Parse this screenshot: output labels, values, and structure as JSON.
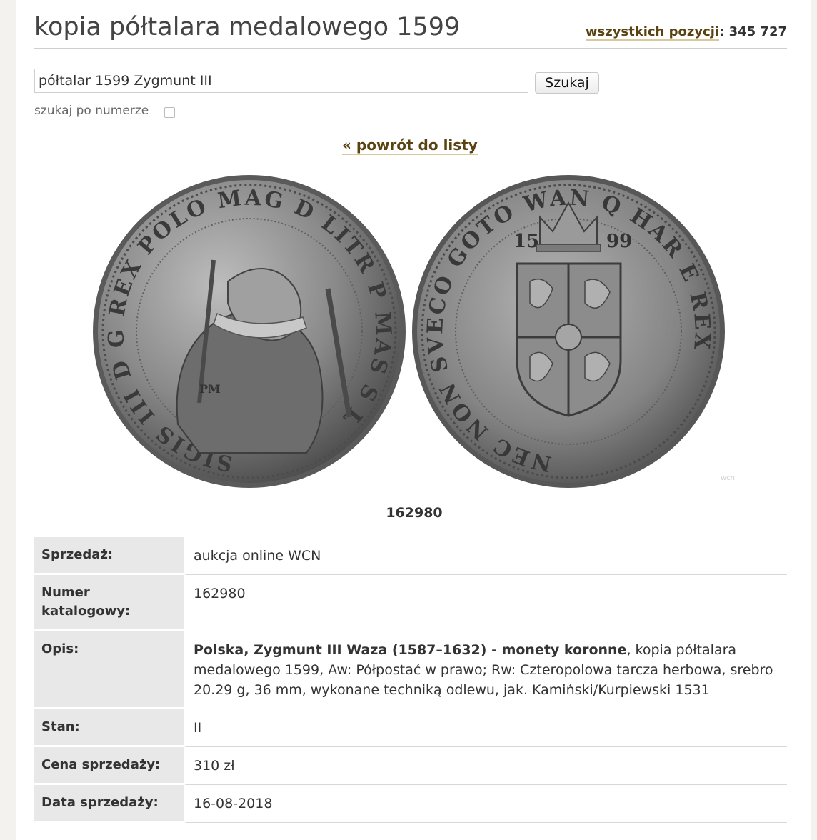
{
  "header": {
    "title": "kopia półtalara medalowego 1599",
    "total_label": "wszystkich pozycji",
    "total_separator": ": ",
    "total_value": "345 727"
  },
  "search": {
    "query": "półtalar 1599 Zygmunt III",
    "button_label": "Szukaj",
    "by_number_label": "szukaj po numerze"
  },
  "nav": {
    "back_label": "« powrót do listy"
  },
  "coin": {
    "obverse_legend": "SIGIS III D G REX POLO MAG D LITR P MAS S L",
    "reverse_legend": "NEC NON SVECO GOTO WAN Q HAR E REX",
    "reverse_year_left": "15",
    "reverse_year_right": "99",
    "mintmark": "PM",
    "watermark": "wcn.pl",
    "metal_color": "#8f8f8f"
  },
  "lot_number": "162980",
  "details": {
    "sale_label": "Sprzedaż:",
    "sale_value": "aukcja online WCN",
    "catalog_label": "Numer katalogowy:",
    "catalog_value": "162980",
    "description_label": "Opis:",
    "description_bold": "Polska, Zygmunt III Waza (1587–1632) - monety koronne",
    "description_rest": ", kopia półtalara medalowego 1599, Aw: Półpostać w prawo; Rw: Czteropolowa tarcza herbowa, srebro 20.29 g, 36 mm, wykonane techniką odlewu, jak. Kamiński/Kurpiewski 1531",
    "condition_label": "Stan:",
    "condition_value": "II",
    "price_label": "Cena sprzedaży:",
    "price_value": "310 zł",
    "date_label": "Data sprzedaży:",
    "date_value": "16-08-2018"
  },
  "colors": {
    "link": "#5a4310",
    "link_underline": "#d8c89c",
    "label_bg": "#e8e8e8"
  }
}
